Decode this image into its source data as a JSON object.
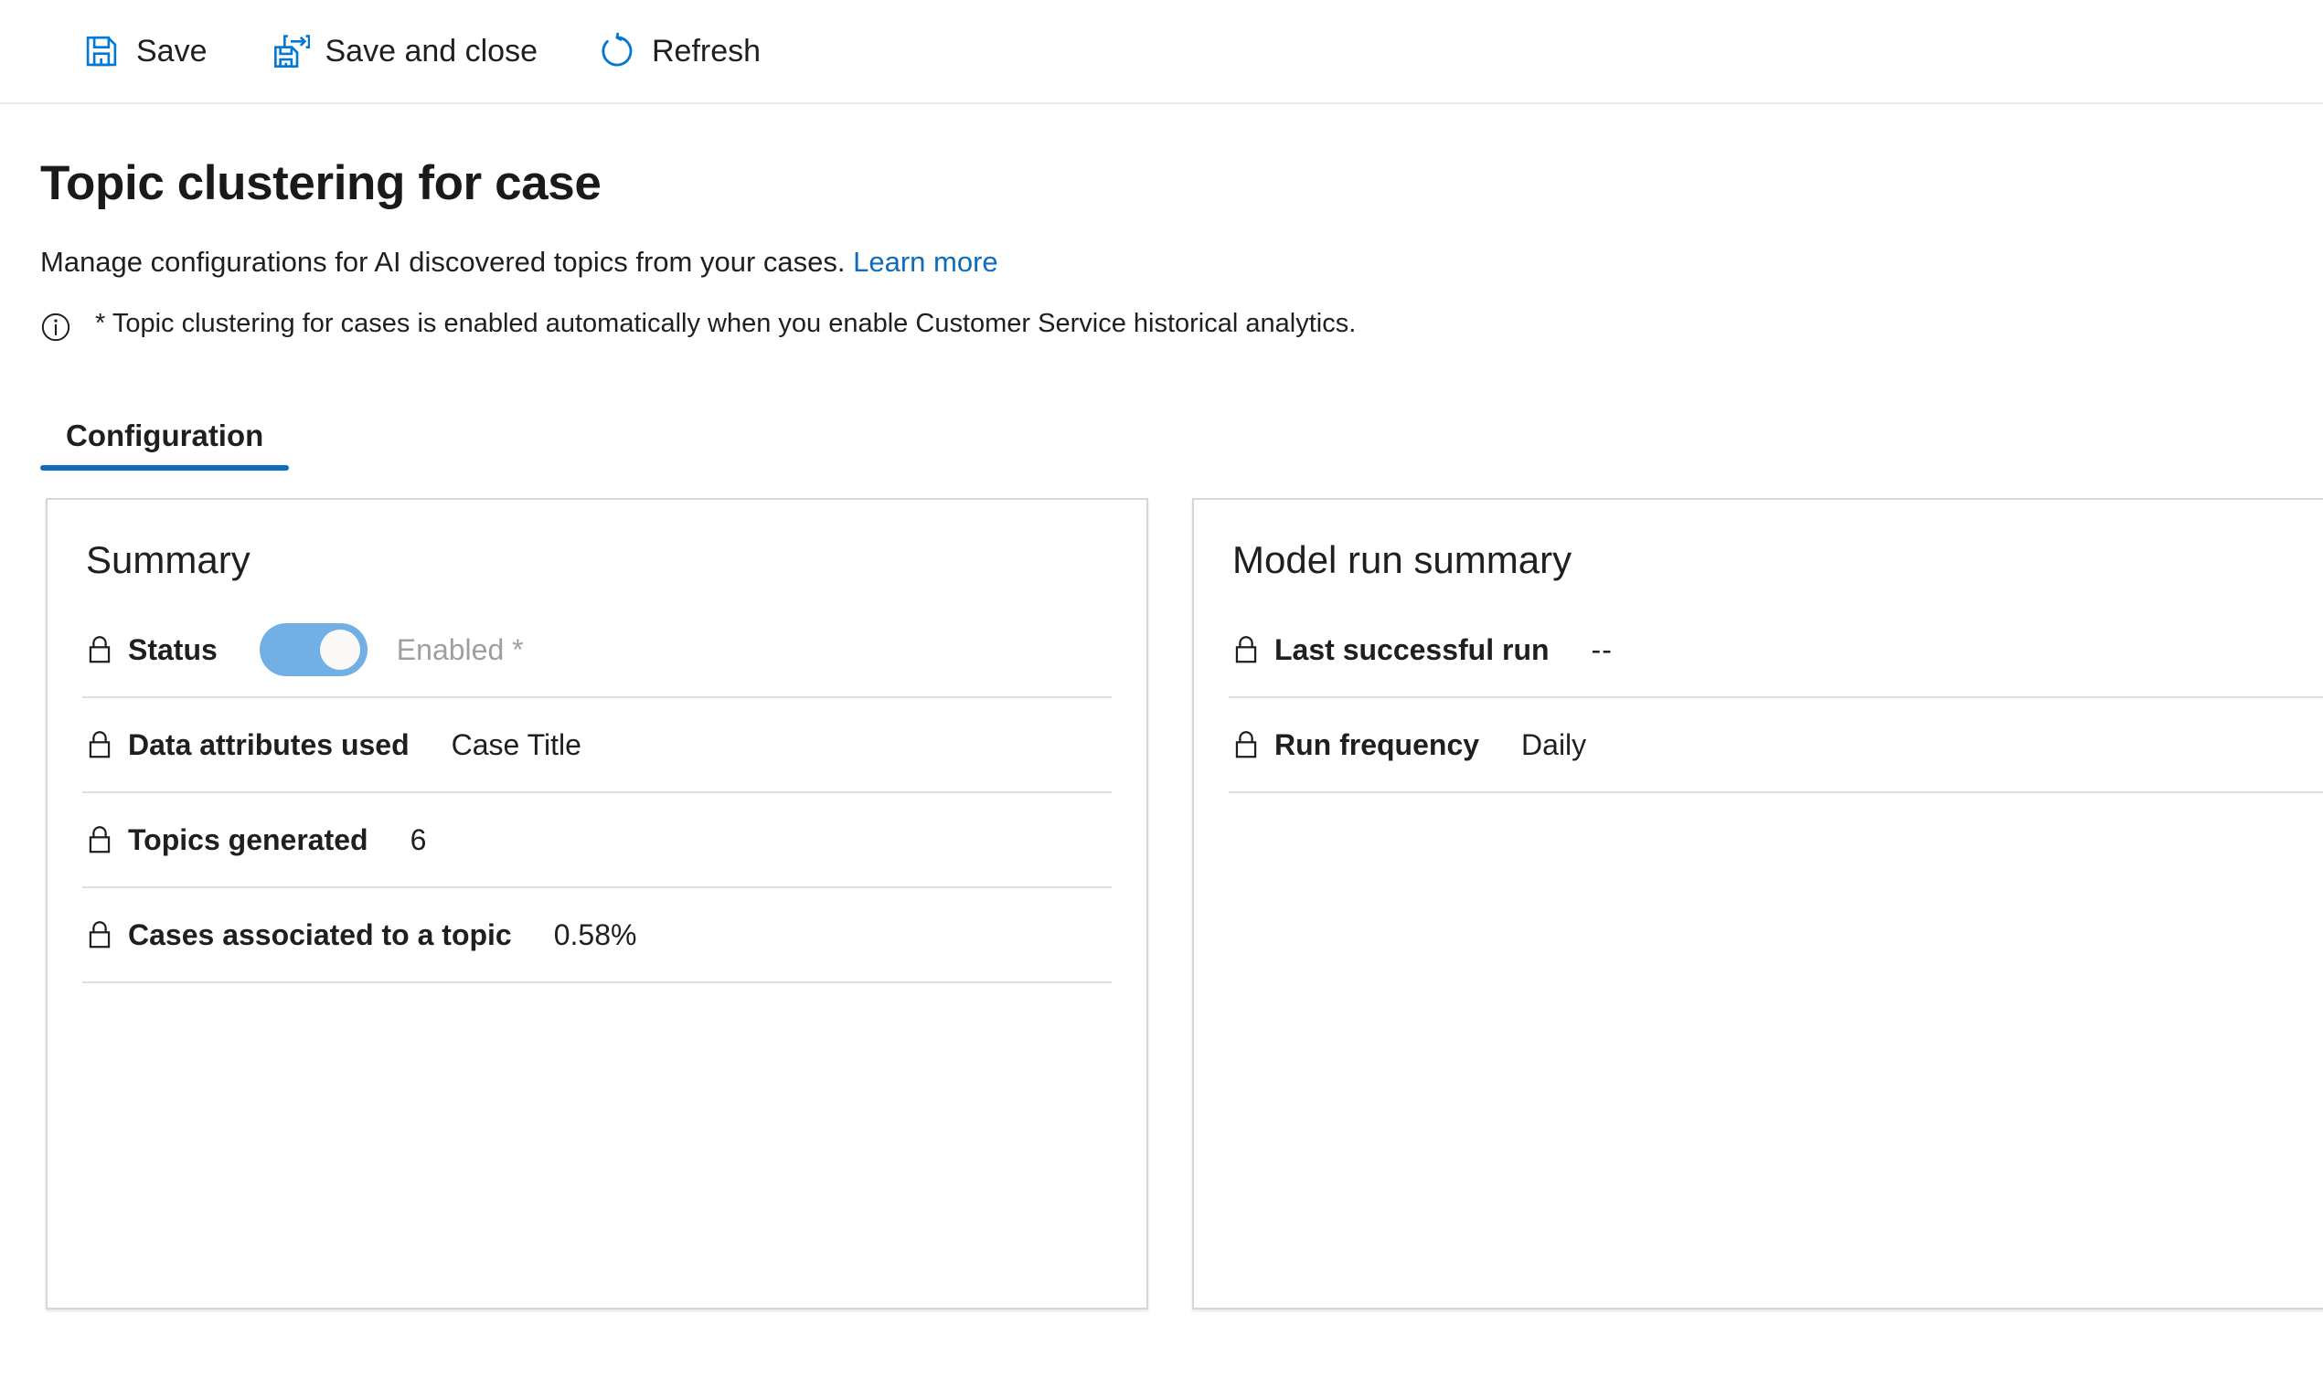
{
  "command_bar": {
    "buttons": [
      {
        "id": "save",
        "label": "Save",
        "icon": "save-icon"
      },
      {
        "id": "save-and-close",
        "label": "Save and close",
        "icon": "save-and-close-icon"
      },
      {
        "id": "refresh",
        "label": "Refresh",
        "icon": "refresh-icon"
      }
    ],
    "accent_color": "#0078d4"
  },
  "header": {
    "title": "Topic clustering for case",
    "subtitle": "Manage configurations for AI discovered topics from your cases.",
    "learn_more_label": "Learn more",
    "note_icon": "info-icon",
    "note": "* Topic clustering for cases is enabled automatically when you enable Customer Service historical analytics."
  },
  "tabs": [
    {
      "id": "configuration",
      "label": "Configuration",
      "active": true
    }
  ],
  "cards": {
    "summary": {
      "title": "Summary",
      "rows": [
        {
          "id": "status",
          "icon": "lock-icon",
          "label": "Status",
          "control": "toggle",
          "toggle_on": true,
          "toggle_text": "Enabled *"
        },
        {
          "id": "data-attributes-used",
          "icon": "lock-icon",
          "label": "Data attributes used",
          "value": "Case Title"
        },
        {
          "id": "topics-generated",
          "icon": "lock-icon",
          "label": "Topics generated",
          "value": "6"
        },
        {
          "id": "cases-associated-to-a-topic",
          "icon": "lock-icon",
          "label": "Cases associated to a topic",
          "value": "0.58%"
        }
      ]
    },
    "model_run_summary": {
      "title": "Model run summary",
      "rows": [
        {
          "id": "last-successful-run",
          "icon": "lock-icon",
          "label": "Last successful run",
          "value": "--"
        },
        {
          "id": "run-frequency",
          "icon": "lock-icon",
          "label": "Run frequency",
          "value": "Daily"
        }
      ]
    }
  },
  "colors": {
    "accent": "#0078d4",
    "link": "#0f6cbd",
    "tab_underline": "#0f6cbd",
    "toggle_on": "#71afe5",
    "muted_text": "#a19f9d",
    "card_border": "#d6d6d6",
    "row_divider": "#e1dfdd"
  }
}
